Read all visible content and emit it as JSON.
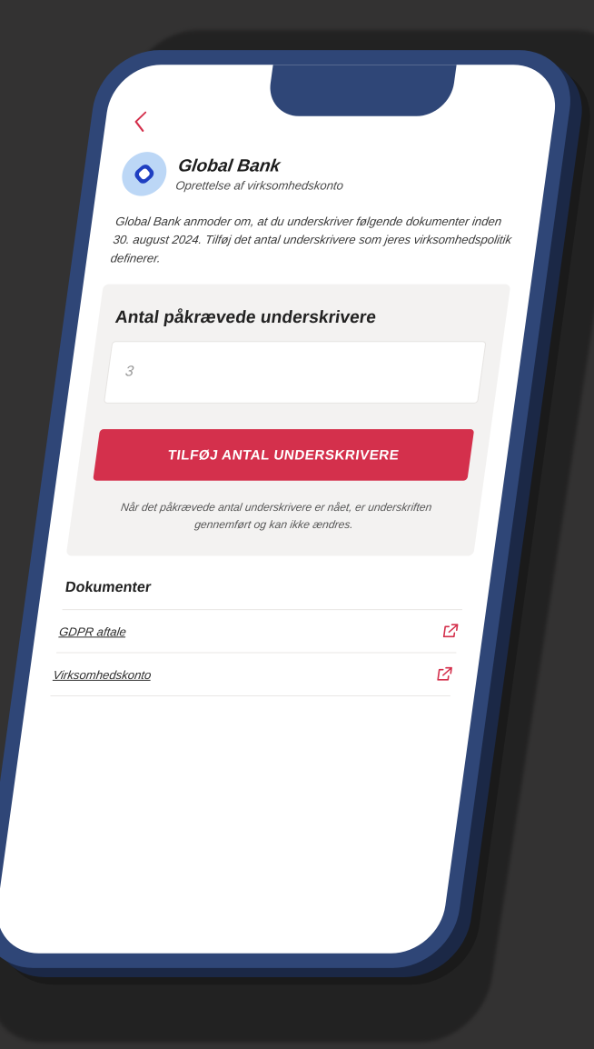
{
  "header": {
    "back_icon": "chevron-left-icon"
  },
  "bank": {
    "name": "Global Bank",
    "subtitle": "Oprettelse af virksomhedskonto",
    "logo_icon": "rounded-square-logo-icon"
  },
  "intro": {
    "text": "Global Bank anmoder om, at du underskriver følgende dokumenter inden 30. august 2024. Tilføj det antal underskrivere som jeres virksomhedspolitik definerer."
  },
  "signers": {
    "title": "Antal påkrævede underskrivere",
    "input_value": "3",
    "button_label": "TILFØJ ANTAL UNDERSKRIVERE",
    "note": "Når det påkrævede antal underskrivere er nået, er underskriften gennemført og kan ikke ændres."
  },
  "documents": {
    "heading": "Dokumenter",
    "items": [
      {
        "label": "GDPR aftale",
        "icon": "external-link-icon"
      },
      {
        "label": "Virksomhedskonto",
        "icon": "external-link-icon"
      }
    ]
  },
  "colors": {
    "accent": "#d4304c",
    "device_frame": "#2f4677",
    "background": "#333232",
    "panel": "#f3f2f1"
  }
}
